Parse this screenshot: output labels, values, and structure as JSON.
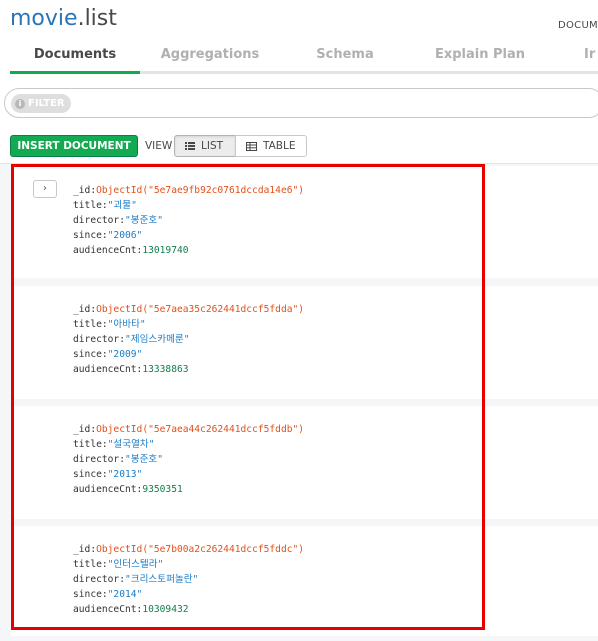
{
  "header": {
    "db": "movie",
    "dot": ".",
    "collection": "list",
    "right_label": "DOCUM"
  },
  "tabs": [
    {
      "label": "Documents",
      "active": true
    },
    {
      "label": "Aggregations",
      "active": false
    },
    {
      "label": "Schema",
      "active": false
    },
    {
      "label": "Explain Plan",
      "active": false
    },
    {
      "label": "Ir",
      "active": false
    }
  ],
  "filter": {
    "pill_label": "FILTER",
    "info_icon": "i"
  },
  "toolbar": {
    "insert_label": "INSERT DOCUMENT",
    "view_label": "VIEW",
    "list_label": "LIST",
    "table_label": "TABLE"
  },
  "colors": {
    "accent": "#13aa52",
    "objectid": "#e4501a",
    "string": "#1b7cc6",
    "number": "#137d4b",
    "highlight": "#e60000"
  },
  "documents": [
    {
      "id_key": "_id:",
      "id_val": "ObjectId(\"5e7ae9fb92c0761dccda14e6\")",
      "title_key": "title:",
      "title_val": "\"괴물\"",
      "director_key": "director:",
      "director_val": "\"봉준호\"",
      "since_key": "since:",
      "since_val": "\"2006\"",
      "aud_key": "audienceCnt:",
      "aud_val": "13019740"
    },
    {
      "id_key": "_id:",
      "id_val": "ObjectId(\"5e7aea35c262441dccf5fdda\")",
      "title_key": "title:",
      "title_val": "\"아바타\"",
      "director_key": "director:",
      "director_val": "\"제임스카메룬\"",
      "since_key": "since:",
      "since_val": "\"2009\"",
      "aud_key": "audienceCnt:",
      "aud_val": "13338863"
    },
    {
      "id_key": "_id:",
      "id_val": "ObjectId(\"5e7aea44c262441dccf5fddb\")",
      "title_key": "title:",
      "title_val": "\"설국열차\"",
      "director_key": "director:",
      "director_val": "\"봉준호\"",
      "since_key": "since:",
      "since_val": "\"2013\"",
      "aud_key": "audienceCnt:",
      "aud_val": "9350351"
    },
    {
      "id_key": "_id:",
      "id_val": "ObjectId(\"5e7b00a2c262441dccf5fddc\")",
      "title_key": "title:",
      "title_val": "\"인터스텔라\"",
      "director_key": "director:",
      "director_val": "\"크리스토퍼놀란\"",
      "since_key": "since:",
      "since_val": "\"2014\"",
      "aud_key": "audienceCnt:",
      "aud_val": "10309432"
    }
  ]
}
